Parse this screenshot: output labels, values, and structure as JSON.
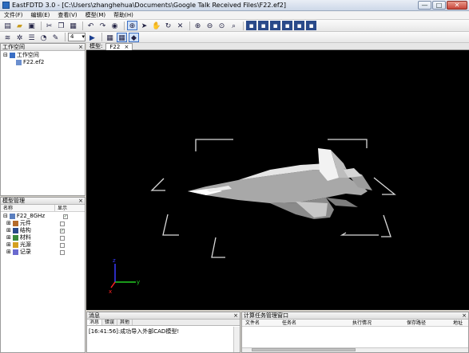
{
  "window": {
    "title": "EastFDTD 3.0 - [C:\\Users\\zhanghehua\\Documents\\Google Talk Received Files\\F22.ef2]",
    "minimize_glyph": "—",
    "maximize_glyph": "□",
    "close_glyph": "✕"
  },
  "menu": {
    "items": [
      {
        "label": "文件(F)"
      },
      {
        "label": "编辑(E)"
      },
      {
        "label": "查看(V)"
      },
      {
        "label": "模型(M)"
      },
      {
        "label": "帮助(H)"
      }
    ]
  },
  "toolbar": {
    "zoom_value": "4",
    "zoom_caret": "▾"
  },
  "workspace_panel": {
    "title": "工作空间",
    "close": "×",
    "root_label": "工作空间",
    "file_label": "F22.ef2"
  },
  "model_panel": {
    "title": "模型管理",
    "close": "×",
    "col_name": "名称",
    "col_show": "显示",
    "root_label": "F22_8GHz",
    "items": [
      {
        "label": "元件",
        "checked": false
      },
      {
        "label": "结构",
        "checked": true
      },
      {
        "label": "材料",
        "checked": false
      },
      {
        "label": "光源",
        "checked": false
      },
      {
        "label": "记录",
        "checked": false
      }
    ],
    "check_glyph": "✓"
  },
  "view": {
    "tab_label": "模型:",
    "file_tab": "F22",
    "file_tab_close": "×",
    "axis_z": "z",
    "axis_x": "x",
    "axis_y": "y"
  },
  "message_panel": {
    "title": "消息",
    "close": "×",
    "tabs": [
      {
        "label": "消息"
      },
      {
        "label": "错误"
      },
      {
        "label": "其他"
      }
    ],
    "text": "[16:41:56]:成功导入外部CAD模型!"
  },
  "task_panel": {
    "title": "计算任务管理窗口",
    "close": "×",
    "columns": [
      "文件名",
      "任务名",
      "执行情况",
      "保存路径",
      "地址"
    ]
  },
  "colors": {
    "viewport_bg": "#000000",
    "axis_z": "#3a3aff",
    "axis_x": "#22cc22",
    "axis_y": "#ff2222",
    "wire": "#d9d9d9",
    "accent": "#2b6bbf"
  },
  "icons": [
    "new-icon",
    "open-icon",
    "save-icon",
    "cut-icon",
    "copy-icon",
    "paste-icon",
    "undo-icon",
    "redo-icon",
    "eye-icon",
    "globe-icon",
    "select-icon",
    "pan-hand-icon",
    "rotate-icon",
    "delete-icon",
    "zoom-in-icon",
    "zoom-out-icon",
    "zoom-fit-icon",
    "zoom-region-icon",
    "view-icon",
    "layers-icon",
    "settings-icon",
    "list-icon",
    "rss-icon",
    "edit-icon",
    "play-icon",
    "grid-icon",
    "mesh-icon",
    "cube-icon"
  ]
}
